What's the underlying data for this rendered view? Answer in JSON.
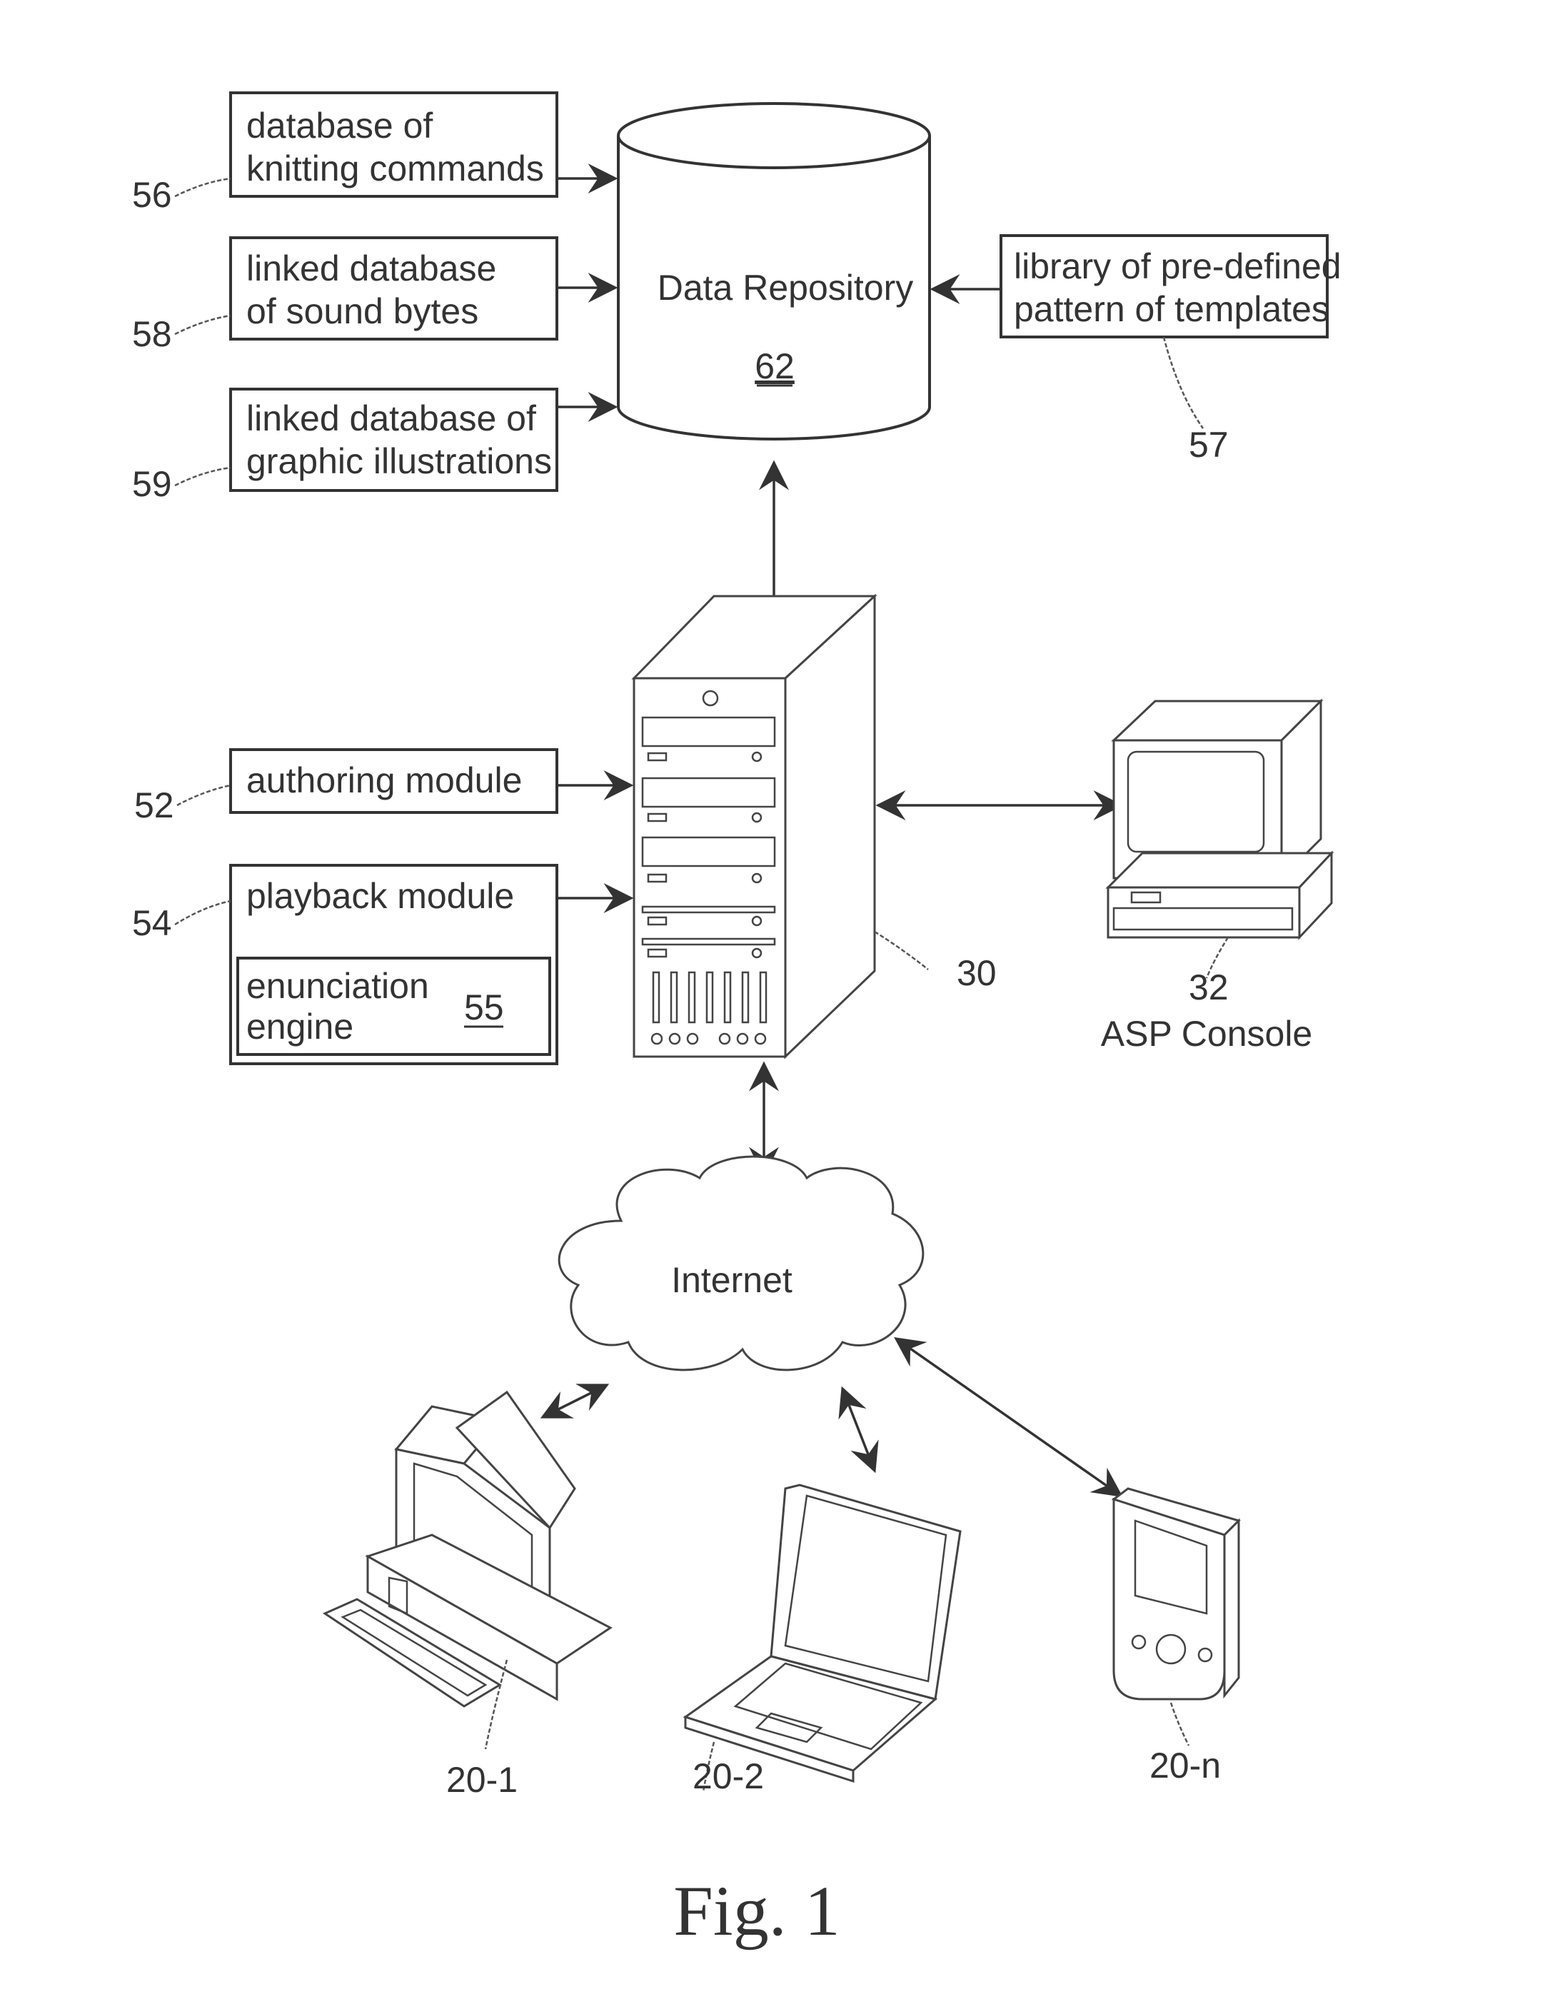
{
  "figure": {
    "title": "Fig. 1"
  },
  "repository": {
    "label": "Data Repository",
    "ref": "62"
  },
  "inputs": [
    {
      "line1": "database of",
      "line2": "knitting commands",
      "ref": "56"
    },
    {
      "line1": "linked database",
      "line2": "of sound bytes",
      "ref": "58"
    },
    {
      "line1": "linked database of",
      "line2": "graphic illustrations",
      "ref": "59"
    }
  ],
  "library": {
    "line1": "library of pre-defined",
    "line2": "pattern of templates",
    "ref": "57"
  },
  "modules": {
    "authoring": {
      "label": "authoring module",
      "ref": "52"
    },
    "playback": {
      "label": "playback module",
      "ref": "54"
    },
    "enunciation": {
      "line1": "enunciation",
      "line2": "engine",
      "ref": "55"
    }
  },
  "server": {
    "ref": "30"
  },
  "console": {
    "ref": "32",
    "label": "ASP Console"
  },
  "network": {
    "label": "Internet"
  },
  "clients": [
    {
      "ref": "20-1",
      "type": "desktop-computer"
    },
    {
      "ref": "20-2",
      "type": "laptop"
    },
    {
      "ref": "20-n",
      "type": "pda"
    }
  ]
}
